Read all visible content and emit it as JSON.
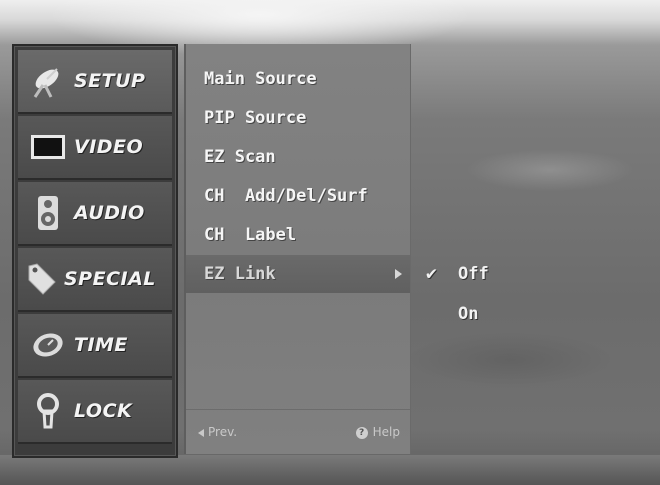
{
  "menu": {
    "items": [
      {
        "label": "SETUP",
        "icon": "satellite-dish-icon",
        "active": true
      },
      {
        "label": "VIDEO",
        "icon": "tv-screen-icon",
        "active": false
      },
      {
        "label": "AUDIO",
        "icon": "speaker-icon",
        "active": false
      },
      {
        "label": "SPECIAL",
        "icon": "tag-icon",
        "active": false
      },
      {
        "label": "TIME",
        "icon": "clock-icon",
        "active": false
      },
      {
        "label": "LOCK",
        "icon": "keyhole-icon",
        "active": false
      }
    ]
  },
  "submenu": {
    "items": [
      {
        "label": "Main Source"
      },
      {
        "label": "PIP Source"
      },
      {
        "label": "EZ Scan"
      },
      {
        "label": "CH  Add/Del/Surf"
      },
      {
        "label": "CH  Label"
      },
      {
        "label": "EZ Link",
        "selected": true
      }
    ],
    "footer": {
      "prev": "Prev.",
      "help": "Help"
    }
  },
  "options": {
    "items": [
      {
        "label": "Off",
        "checked": true,
        "check_glyph": "✔"
      },
      {
        "label": "On",
        "checked": false
      }
    ]
  },
  "colors": {
    "menu_bg": "#3c3c3c",
    "submenu_bg": "#808080",
    "text": "#f4f4f4"
  }
}
